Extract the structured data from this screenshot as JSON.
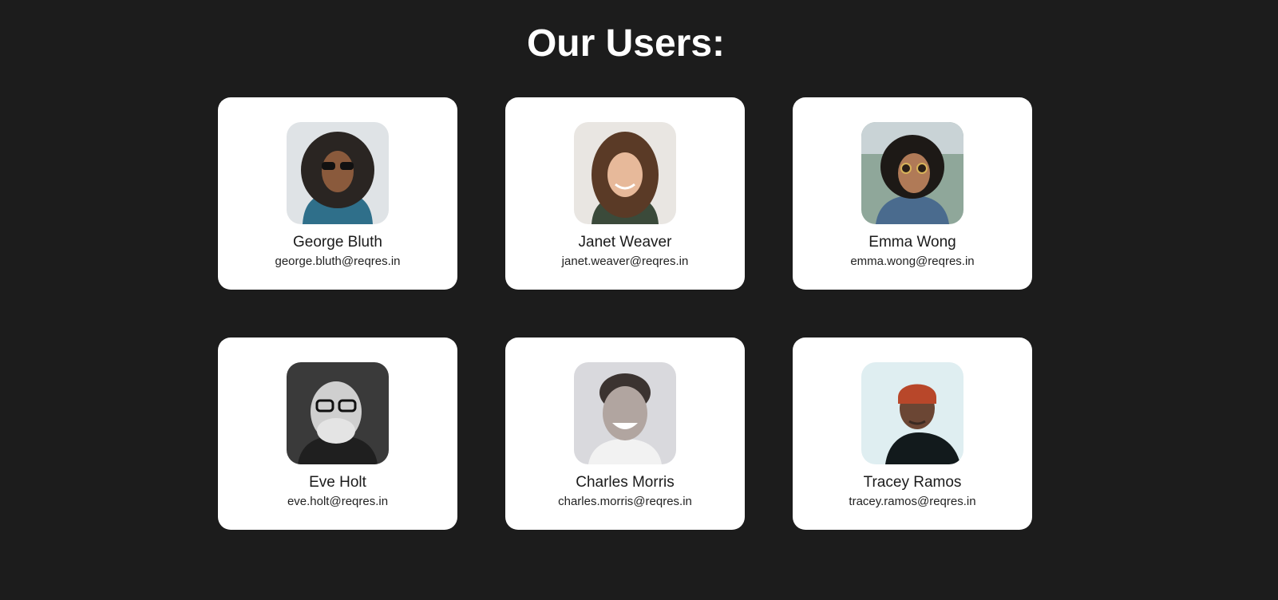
{
  "page": {
    "title": "Our Users:"
  },
  "users": [
    {
      "name": "George Bluth",
      "email": "george.bluth@reqres.in"
    },
    {
      "name": "Janet Weaver",
      "email": "janet.weaver@reqres.in"
    },
    {
      "name": "Emma Wong",
      "email": "emma.wong@reqres.in"
    },
    {
      "name": "Eve Holt",
      "email": "eve.holt@reqres.in"
    },
    {
      "name": "Charles Morris",
      "email": "charles.morris@reqres.in"
    },
    {
      "name": "Tracey Ramos",
      "email": "tracey.ramos@reqres.in"
    }
  ],
  "colors": {
    "background": "#1c1c1c",
    "card": "#ffffff",
    "title": "#ffffff",
    "text": "#1b1b1b"
  }
}
